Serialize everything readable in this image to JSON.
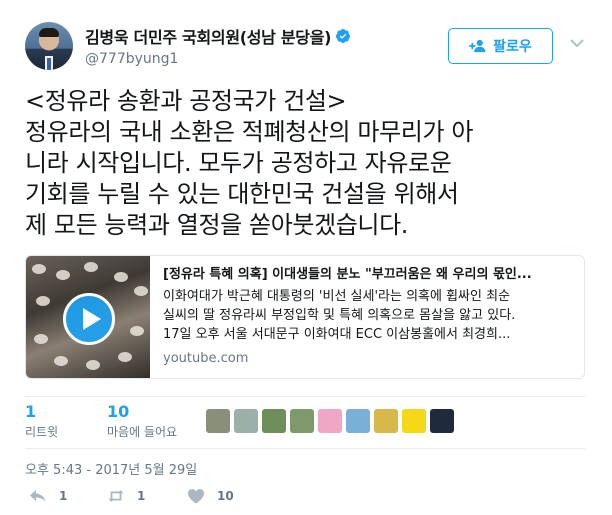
{
  "author": {
    "display_name": "김병욱 더민주 국회의원(성남 분당을)",
    "handle": "@777byung1",
    "verified": true
  },
  "follow_button": {
    "label": "팔로우"
  },
  "tweet": {
    "lines": [
      "<정유라 송환과 공정국가 건설>",
      "정유라의 국내 소환은 적폐청산의 마무리가 아",
      "니라 시작입니다. 모두가 공정하고 자유로운",
      "기회를 누릴 수 있는 대한민국 건설을 위해서",
      "제 모든 능력과 열정을 쏟아붓겠습니다."
    ]
  },
  "card": {
    "title": "[정유라 특혜 의혹] 이대생들의 분노 \"부끄러움은 왜 우리의 몫인...",
    "description_lines": [
      "이화여대가 박근혜 대통령의 '비선 실세'라는 의혹에 휩싸인 최순",
      "실씨의 딸 정유라씨 부정입학 및 특혜 의혹으로 몸살을 앓고 있다.",
      "17일 오후 서울 서대문구 이화여대 ECC 이삼봉홀에서 최경희..."
    ],
    "domain": "youtube.com"
  },
  "stats": {
    "retweets": {
      "count": "1",
      "label": "리트윗"
    },
    "likes": {
      "count": "10",
      "label": "마음에 들어요"
    }
  },
  "likers": [
    {
      "icon": "liker-avatar-1",
      "color": "#8a8f7a"
    },
    {
      "icon": "liker-avatar-2",
      "color": "#9bb0a8"
    },
    {
      "icon": "liker-avatar-3",
      "color": "#6f8f5a"
    },
    {
      "icon": "liker-avatar-4",
      "color": "#7f9a6a"
    },
    {
      "icon": "liker-avatar-5",
      "color": "#f0a6c4"
    },
    {
      "icon": "liker-avatar-6",
      "color": "#7ab0d8"
    },
    {
      "icon": "liker-avatar-7",
      "color": "#d8b84a"
    },
    {
      "icon": "liker-avatar-8",
      "color": "#f5d816"
    },
    {
      "icon": "liker-avatar-9",
      "color": "#1f2b3d"
    }
  ],
  "timestamp": "오후 5:43 - 2017년 5월 29일",
  "actions": {
    "reply": {
      "icon": "reply-icon",
      "count": "1"
    },
    "retweet": {
      "icon": "retweet-icon",
      "count": "1"
    },
    "like": {
      "icon": "heart-icon",
      "count": "10"
    }
  },
  "colors": {
    "accent": "#1da1f2",
    "text": "#14171a",
    "muted": "#657786",
    "border": "#e1e8ed"
  }
}
